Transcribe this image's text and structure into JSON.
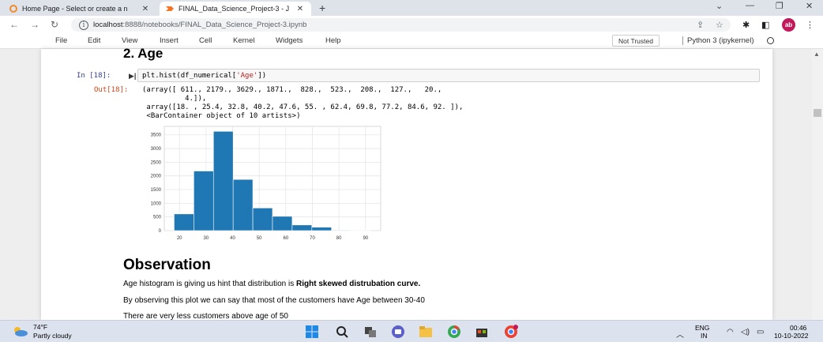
{
  "browser": {
    "tabs": [
      {
        "title": "Home Page - Select or create a n",
        "close": "✕"
      },
      {
        "title": "FINAL_Data_Science_Project-3 - J",
        "close": "✕"
      }
    ],
    "new_tab": "+",
    "window_controls": [
      "⌄",
      "—",
      "❐",
      "✕"
    ],
    "url_host": "localhost",
    "url_path": ":8888/notebooks/FINAL_Data_Science_Project-3.ipynb",
    "avatar_initials": "ab"
  },
  "jupyter": {
    "menu": [
      "File",
      "Edit",
      "View",
      "Insert",
      "Cell",
      "Kernel",
      "Widgets",
      "Help"
    ],
    "trust_label": "Not Trusted",
    "kernel_name": "Python 3 (ipykernel)"
  },
  "notebook": {
    "heading": "2. Age",
    "in_prompt": "In [18]:",
    "out_prompt": "Out[18]:",
    "code_prefix": "plt.hist(df_numerical[",
    "code_string": "'Age'",
    "code_suffix": "])",
    "output_lines": [
      "(array([ 611., 2179., 3629., 1871.,  828.,  523.,  208.,  127.,   20.,",
      "          4.]),",
      " array([18. , 25.4, 32.8, 40.2, 47.6, 55. , 62.4, 69.8, 77.2, 84.6, 92. ]),",
      " <BarContainer object of 10 artists>)"
    ],
    "observation_title": "Observation",
    "md_line1_prefix": "Age histogram is giving us hint that distribution is ",
    "md_line1_bold": "Right skewed distrubation curve.",
    "md_line2": "By observing this plot we can say that most of the customers have Age between 30-40",
    "md_line3": "There are very less customers above age of 50"
  },
  "chart_data": {
    "type": "bar",
    "bin_edges": [
      18,
      25.4,
      32.8,
      40.2,
      47.6,
      55,
      62.4,
      69.8,
      77.2,
      84.6,
      92
    ],
    "values": [
      611,
      2179,
      3629,
      1871,
      828,
      523,
      208,
      127,
      20,
      4
    ],
    "xlim": [
      14.3,
      95.7
    ],
    "ylim": [
      0,
      3810
    ],
    "xticks": [
      20,
      30,
      40,
      50,
      60,
      70,
      80,
      90
    ],
    "yticks": [
      0,
      500,
      1000,
      1500,
      2000,
      2500,
      3000,
      3500
    ],
    "bar_color": "#1f77b4",
    "grid": true
  },
  "taskbar": {
    "temperature": "74°F",
    "weather": "Partly cloudy",
    "lang1": "ENG",
    "lang2": "IN",
    "time": "00:46",
    "date": "10-10-2022"
  }
}
